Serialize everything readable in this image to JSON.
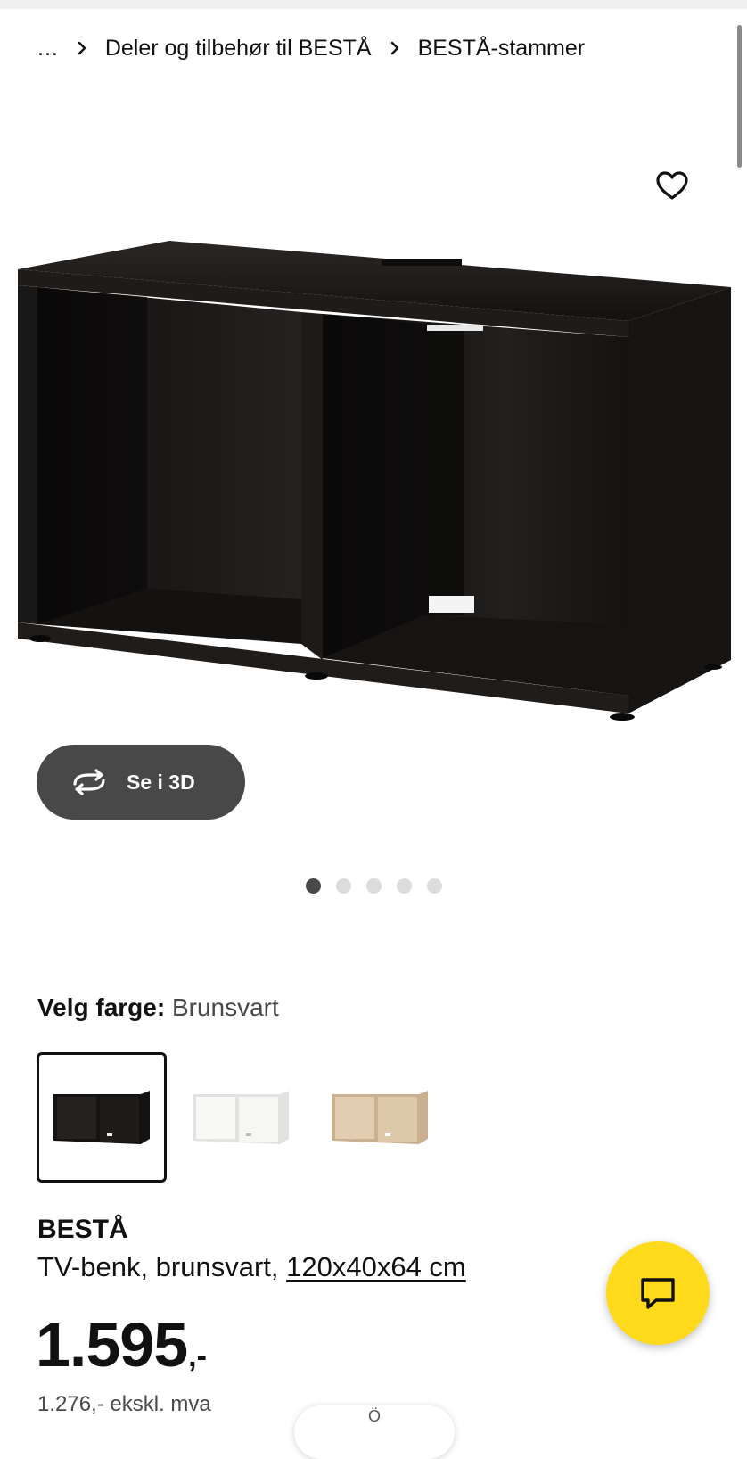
{
  "breadcrumb": {
    "ellipsis": "...",
    "items": [
      "Deler og tilbehør til BESTÅ",
      "BESTÅ-stammer"
    ]
  },
  "icons": {
    "favorite": "heart-outline-icon",
    "rotate": "rotate-3d-icon",
    "chat": "chat-bubble-icon",
    "chevron": "chevron-right-icon"
  },
  "viewer": {
    "see_3d_label": "Se i 3D",
    "image_count": 5,
    "active_image": 1
  },
  "color": {
    "label": "Velg farge:",
    "selected": "Brunsvart",
    "options_count": 3
  },
  "product": {
    "name": "BESTÅ",
    "desc_prefix": "TV-benk, brunsvart, ",
    "dimensions": "120x40x64 cm"
  },
  "price": {
    "amount": "1.595",
    "suffix": ",-",
    "excl_vat": "1.276,- ekskl. mva"
  },
  "bottom_pill_text": "Ö",
  "colors": {
    "accent_yellow": "#ffda1a",
    "button_dark": "#484848",
    "cabinet_black_brown": "#1a1816",
    "cabinet_white": "#f4f4f2",
    "cabinet_oak": "#d8c2a4"
  }
}
